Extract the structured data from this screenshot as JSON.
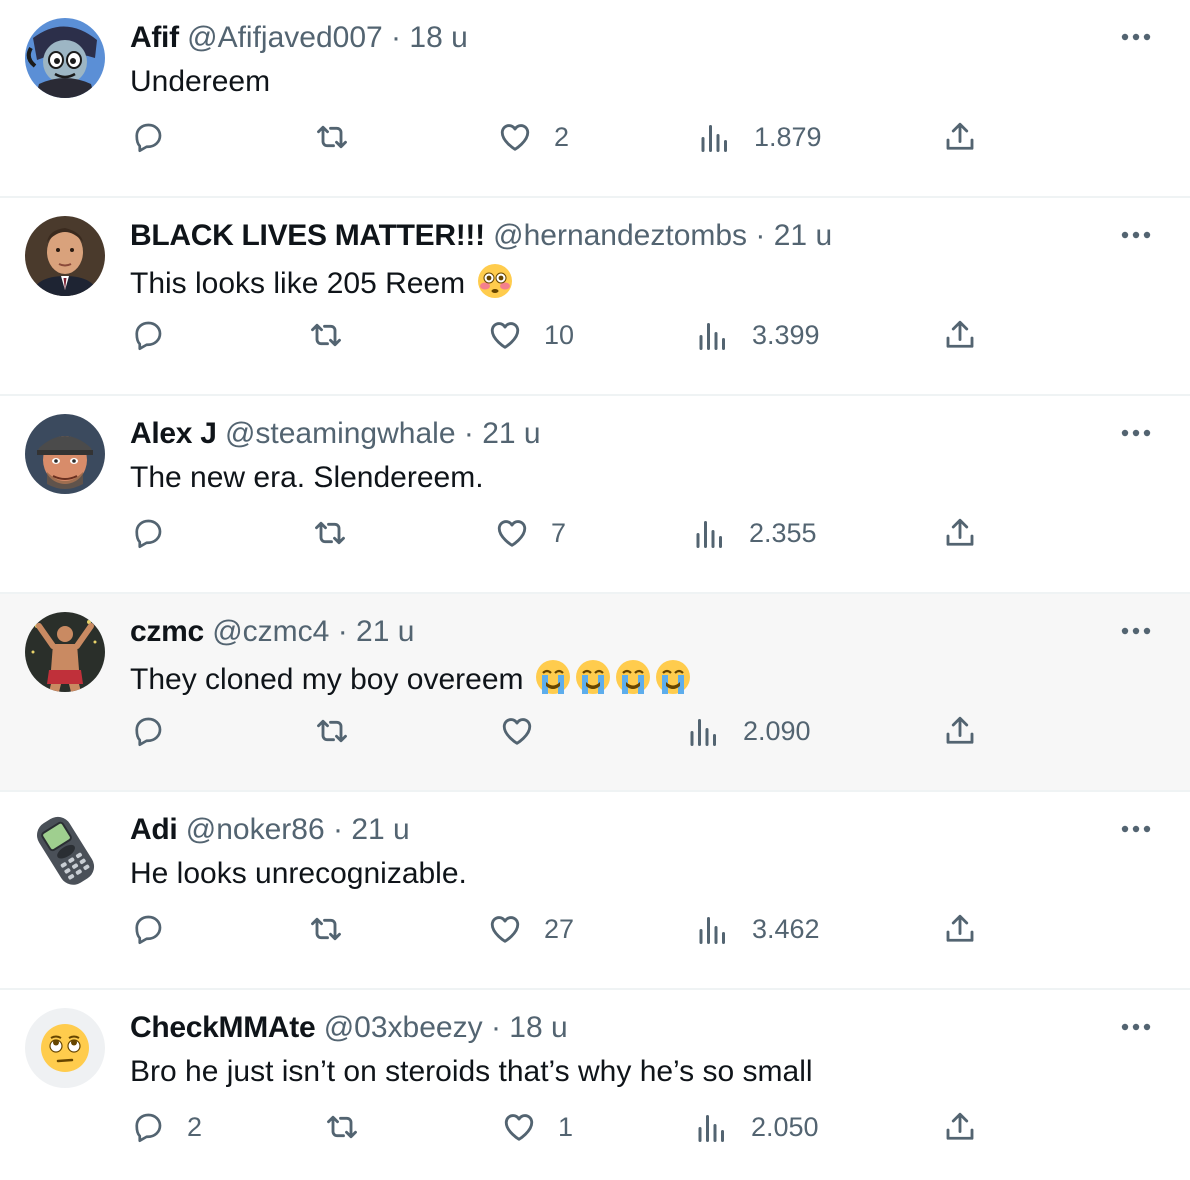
{
  "colors": {
    "text": "#0f1419",
    "muted": "#536471",
    "divider": "#eff3f4",
    "hover_bg": "#f7f7f7"
  },
  "replies": [
    {
      "name": "Afif",
      "handle": "@Afifjaved007",
      "dot": "·",
      "time": "18 u",
      "text": "Undereem",
      "emoji": "",
      "avatar_icon": "cartoon-avatar-icon",
      "stats": {
        "replies": "",
        "retweets": "",
        "likes": "2",
        "views": "1.879"
      }
    },
    {
      "name": "BLACK LIVES MATTER!!!",
      "handle": "@hernandeztombs",
      "dot": "·",
      "time": "21 u",
      "text": "This looks like 205 Reem",
      "emoji": "flushed-face-emoji",
      "avatar_icon": "man-portrait-avatar-icon",
      "stats": {
        "replies": "",
        "retweets": "",
        "likes": "10",
        "views": "3.399"
      }
    },
    {
      "name": "Alex J",
      "handle": "@steamingwhale",
      "dot": "·",
      "time": "21 u",
      "text": "The new era. Slendereem.",
      "emoji": "",
      "avatar_icon": "man-with-cap-avatar-icon",
      "stats": {
        "replies": "",
        "retweets": "",
        "likes": "7",
        "views": "2.355"
      }
    },
    {
      "name": "czmc",
      "handle": "@czmc4",
      "dot": "·",
      "time": "21 u",
      "text": "They cloned my boy overeem",
      "emoji": "loudly-crying-face-emoji-x4",
      "avatar_icon": "fighter-avatar-icon",
      "stats": {
        "replies": "",
        "retweets": "",
        "likes": "",
        "views": "2.090"
      }
    },
    {
      "name": "Adi",
      "handle": "@noker86",
      "dot": "·",
      "time": "21 u",
      "text": "He looks unrecognizable.",
      "emoji": "",
      "avatar_icon": "nokia-phone-avatar-icon",
      "stats": {
        "replies": "",
        "retweets": "",
        "likes": "27",
        "views": "3.462"
      }
    },
    {
      "name": "CheckMMAte",
      "handle": "@03xbeezy",
      "dot": "·",
      "time": "18 u",
      "text": "Bro he just isn’t on steroids that’s why he’s so small",
      "emoji": "",
      "avatar_icon": "eye-roll-emoji-avatar-icon",
      "stats": {
        "replies": "2",
        "retweets": "",
        "likes": "1",
        "views": "2.050"
      }
    }
  ]
}
